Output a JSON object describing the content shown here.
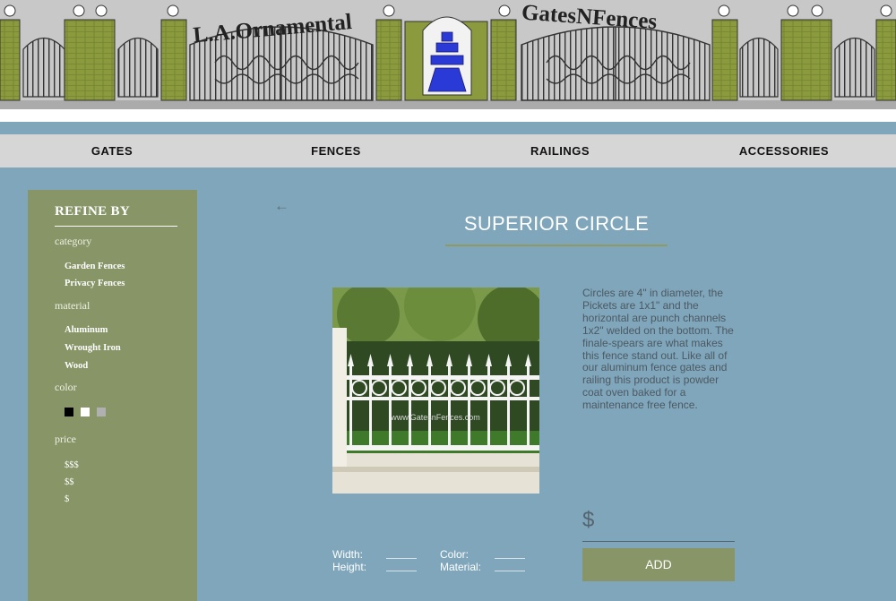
{
  "banner": {
    "left_logo": "L.A.Ornamental",
    "right_logo": "GatesNFences"
  },
  "nav": {
    "items": [
      "GATES",
      "FENCES",
      "RAILINGS",
      "ACCESSORIES"
    ]
  },
  "sidebar": {
    "heading": "REFINE BY",
    "category_label": "category",
    "categories": [
      "Garden Fences",
      "Privacy Fences"
    ],
    "material_label": "material",
    "materials": [
      "Aluminum",
      "Wrought Iron",
      "Wood"
    ],
    "color_label": "color",
    "colors": [
      "#000000",
      "#ffffff",
      "#b0b0b0"
    ],
    "price_label": "price",
    "prices": [
      "$$$",
      "$$",
      "$"
    ]
  },
  "product": {
    "title": "SUPERIOR CIRCLE",
    "image_watermark": "www.GatesnFences.com",
    "description": "Circles are 4\" in diameter, the Pickets are 1x1\" and the horizontal are punch channels 1x2\" welded on the bottom. The finale-spears are what makes this fence stand out. Like all of our aluminum fence gates and railing this product is powder coat oven baked for a maintenance free fence.",
    "price_symbol": "$",
    "add_label": "ADD",
    "width_label": "Width:",
    "height_label": "Height:",
    "color_label": "Color:",
    "material_label": "Material:"
  },
  "icons": {
    "back": "arrow-left-icon"
  }
}
